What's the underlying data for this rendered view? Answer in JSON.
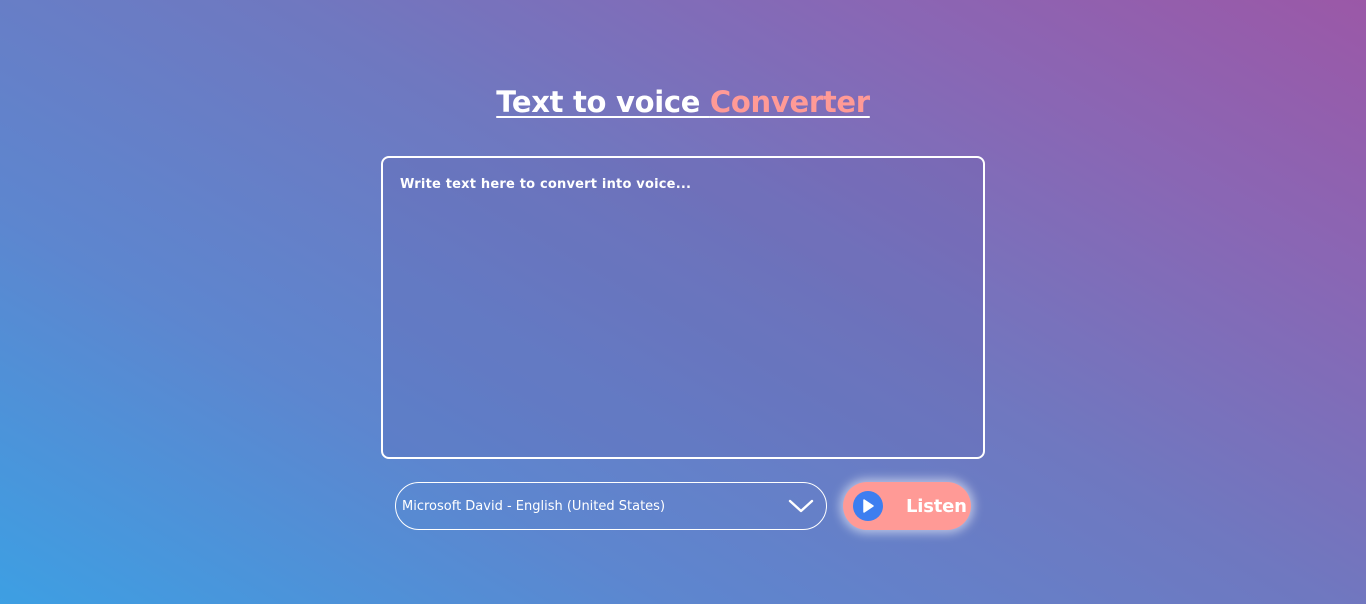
{
  "header": {
    "title_part1": "Text to voice ",
    "title_part2": "Converter"
  },
  "editor": {
    "placeholder": "Write text here to convert into voice...",
    "value": ""
  },
  "voice_select": {
    "selected": "Microsoft David - English (United States)",
    "icon": "chevron-down-icon"
  },
  "listen_button": {
    "label": "Listen",
    "icon": "play-icon"
  },
  "colors": {
    "accent": "#ff9a96",
    "play_icon_bg": "#3d7ef0",
    "gradient_start": "#3d9fe3",
    "gradient_end": "#9b58a7"
  }
}
